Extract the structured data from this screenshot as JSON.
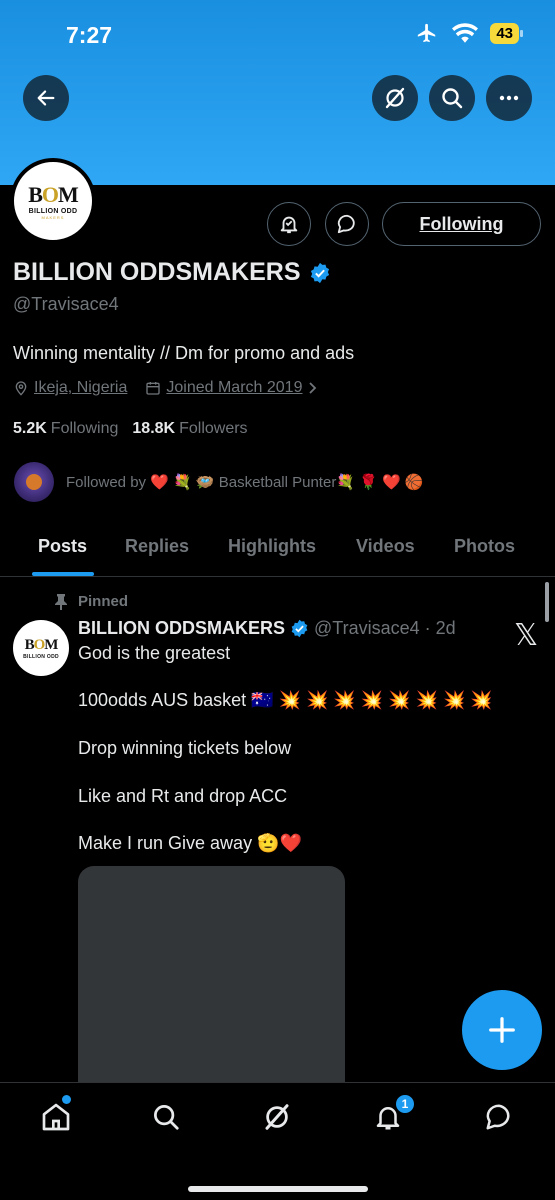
{
  "status_bar": {
    "time": "7:27",
    "battery": "43"
  },
  "profile": {
    "logo_text": "BOM",
    "logo_subtitle": "BILLION ODD",
    "logo_subtitle2": "MAKERS",
    "name": "BILLION ODDSMAKERS",
    "handle": "@Travisace4",
    "bio": "Winning mentality // Dm for promo and ads",
    "location": "Ikeja, Nigeria",
    "joined": "Joined March 2019",
    "following_count": "5.2K",
    "following_label": "Following",
    "followers_count": "18.8K",
    "followers_label": "Followers",
    "followed_by": "Followed by ❤️ 💐 🪺 Basketball Punter💐 🌹 ❤️ 🏀",
    "follow_button": "Following"
  },
  "tabs": [
    {
      "label": "Posts",
      "active": true
    },
    {
      "label": "Replies",
      "active": false
    },
    {
      "label": "Highlights",
      "active": false
    },
    {
      "label": "Videos",
      "active": false
    },
    {
      "label": "Photos",
      "active": false
    }
  ],
  "post": {
    "pinned_label": "Pinned",
    "author": "BILLION ODDSMAKERS",
    "handle_time": "@Travisace4 · 2d",
    "lines": [
      "God is the greatest",
      "100odds AUS basket 🇦🇺 💥 💥 💥 💥 💥 💥 💥 💥",
      "Drop winning tickets below",
      "Like and Rt and drop ACC",
      "Make I run Give away 🫡❤️"
    ]
  },
  "nav": {
    "notification_count": "1"
  },
  "colors": {
    "accent": "#1d9bf0",
    "banner": "#2fa7f4",
    "muted": "#71767b",
    "background": "#000000"
  },
  "icons": [
    "back-arrow-icon",
    "grok-icon",
    "search-icon",
    "more-icon",
    "notification-bell-icon",
    "message-icon",
    "location-icon",
    "calendar-icon",
    "verified-icon",
    "pin-icon",
    "x-logo-icon",
    "plus-icon",
    "home-icon"
  ]
}
